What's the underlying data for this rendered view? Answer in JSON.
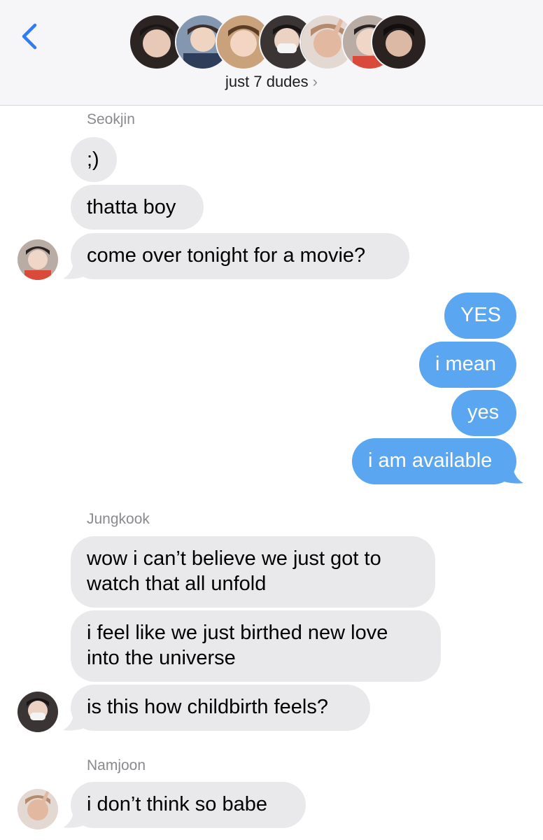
{
  "header": {
    "group_name": "just 7 dudes",
    "chevron": "›",
    "back_icon": "chevron-left-icon",
    "avatar_colors": [
      "#3a2d28",
      "#6b5c55",
      "#7a5a42",
      "#2e2a2a",
      "#c9a48a",
      "#8a7b70",
      "#2a2220"
    ]
  },
  "conversation": {
    "senders": {
      "seokjin": "Seokjin",
      "jungkook": "Jungkook",
      "namjoon": "Namjoon"
    },
    "seokjin_messages": [
      ";)",
      "thatta boy",
      "come over tonight for a movie?"
    ],
    "my_messages": [
      "YES",
      "i mean",
      "yes",
      "i am available"
    ],
    "jungkook_messages": [
      "wow i can’t believe we just got to\nwatch that all unfold",
      "i feel like we just birthed new love\ninto the universe",
      "is this how childbirth feels?"
    ],
    "namjoon_messages": [
      "i don’t think so babe"
    ]
  },
  "colors": {
    "incoming_bubble": "#e9e9eb",
    "outgoing_bubble": "#5aa6f0",
    "accent": "#2f7cf6"
  }
}
